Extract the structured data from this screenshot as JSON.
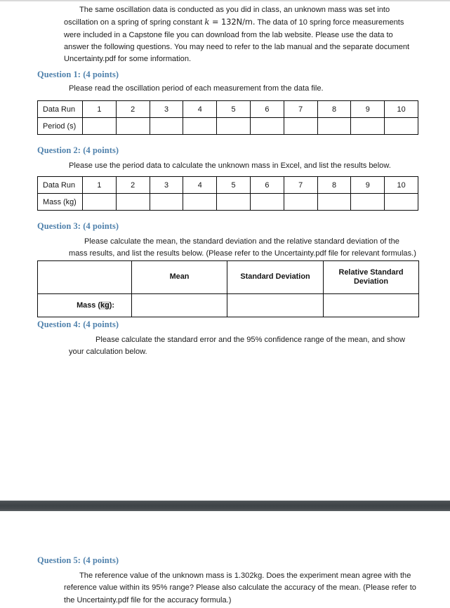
{
  "document": {
    "intro_paragraph": "The same oscillation data is conducted as you did in class, an unknown mass was set into oscillation on a spring of spring constant ",
    "intro_math_var": "k",
    "intro_math_eq": " = 132N/m.",
    "intro_paragraph_cont": " The data of 10 spring force measurements were included in a Capstone file you can download from the lab website. Please use the data to answer the following questions. You may need to refer to the lab manual and the separate document Uncertainty.pdf for some information."
  },
  "questions": {
    "q1": {
      "heading": "Question 1: (4 points)",
      "prompt": "Please read the oscillation period of each measurement from the data file.",
      "table": {
        "row_label_1": "Data Run",
        "row_label_2": "Period (s)",
        "runs": [
          "1",
          "2",
          "3",
          "4",
          "5",
          "6",
          "7",
          "8",
          "9",
          "10"
        ],
        "values": [
          "",
          "",
          "",
          "",
          "",
          "",
          "",
          "",
          "",
          ""
        ]
      }
    },
    "q2": {
      "heading": "Question 2: (4 points)",
      "prompt": "Please use the period data to calculate the unknown mass in Excel, and list the results below.",
      "table": {
        "row_label_1": "Data Run",
        "row_label_2": "Mass (kg)",
        "runs": [
          "1",
          "2",
          "3",
          "4",
          "5",
          "6",
          "7",
          "8",
          "9",
          "10"
        ],
        "values": [
          "",
          "",
          "",
          "",
          "",
          "",
          "",
          "",
          "",
          ""
        ]
      }
    },
    "q3": {
      "heading": "Question 3: (4 points)",
      "prompt": "Please calculate the mean, the standard deviation and the relative standard deviation of the mass results, and list the results below. (Please refer to the Uncertainty.pdf file for relevant formulas.)",
      "table": {
        "corner": "",
        "headers": [
          "Mean",
          "Standard Deviation",
          "Relative Standard Deviation"
        ],
        "row_label_prefix": "Mass (",
        "row_label_highlight": "kg",
        "row_label_suffix": "):",
        "values": [
          "",
          "",
          ""
        ]
      }
    },
    "q4": {
      "heading": "Question 4: (4 points)",
      "prompt": "Please calculate the standard error and the 95% confidence range of the mean, and show your calculation below."
    },
    "q5": {
      "heading": "Question 5: (4 points)",
      "prompt": "The reference value of the unknown mass is 1.302kg. Does the experiment mean agree with the reference value within its 95% range? Please also calculate the accuracy of the mean. (Please refer to the Uncertainty.pdf file for the accuracy formula.)"
    }
  },
  "colors": {
    "heading_blue": "#4f81ac",
    "page_divider": "#3e4347",
    "text": "#1b1b1b",
    "table_border": "#0a0a0a",
    "highlight": "#d9d9d9"
  }
}
